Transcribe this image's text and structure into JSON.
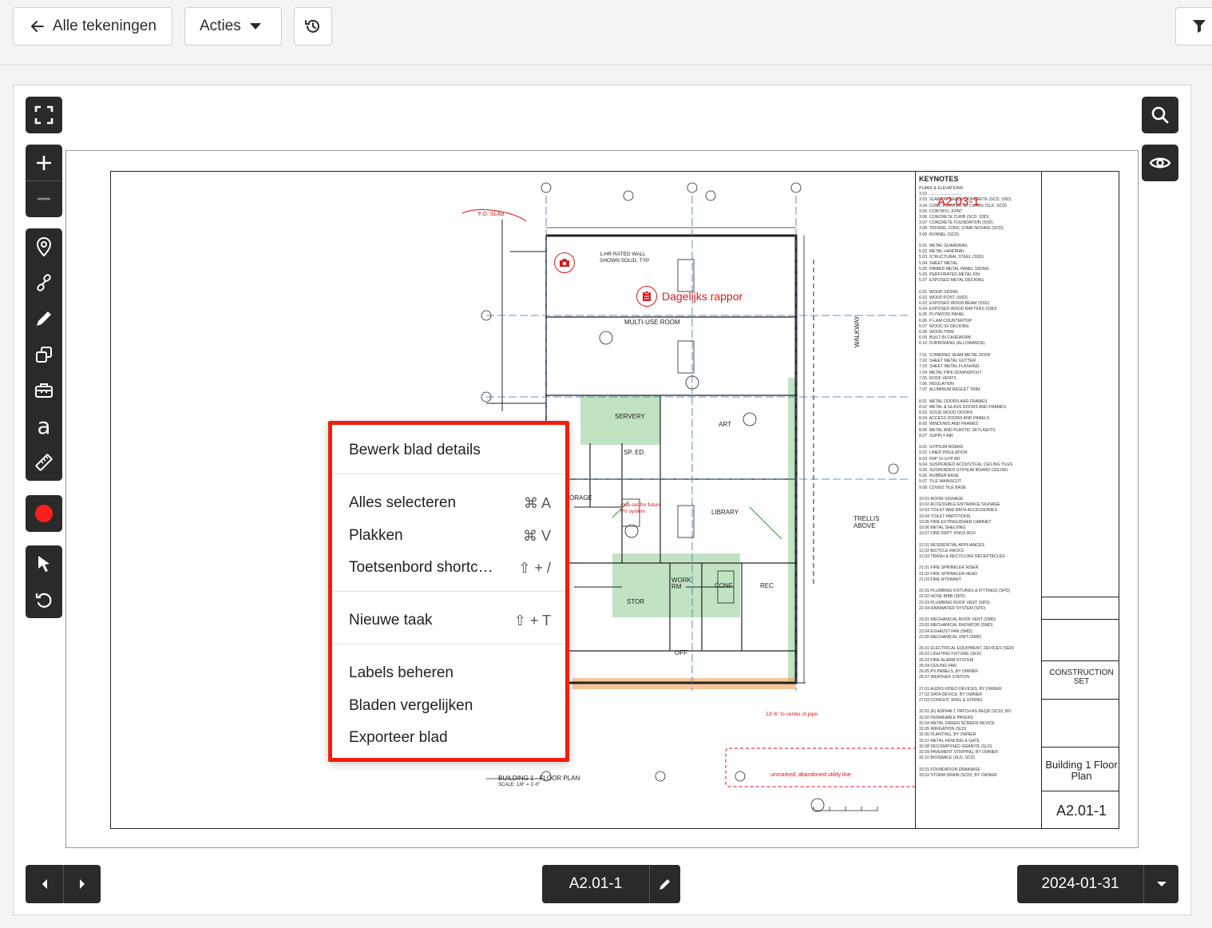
{
  "toolbar": {
    "back_label": "Alle tekeningen",
    "actions_label": "Acties"
  },
  "markups": {
    "daily_report": "Dagelijks rappor",
    "sheet_ref": "A2.03-1"
  },
  "plan_labels": {
    "multi_use": "MULTI-USE ROOM",
    "servery": "SERVERY",
    "art": "ART",
    "library": "LIBRARY",
    "sp_ed": "SP. ED.",
    "storage": "ORAGE",
    "work_rm": "WORK RM",
    "conf": "CONF",
    "rec": "REC",
    "off": "OFF",
    "stor": "STOR",
    "walkway": "WALKWAY",
    "trellis": "TRELLIS ABOVE",
    "building_plan": "BUILDING 1 - FLOOR PLAN",
    "scale": "SCALE: 1/8\" = 1'-0\"",
    "stub_out": "stub out for future PV system",
    "unmarked": "unmarked, abandoned utility line",
    "fo_slab": "F.O. SLAB",
    "rated_wall": "1-HR RATED WALL SHOWN SOLID, TYP",
    "center_pipe": "13'-6\" to center of pipe"
  },
  "title_block": {
    "keynotes_title": "KEYNOTES",
    "construction_set": "CONSTRUCTION SET",
    "sheet_title": "Building 1 Floor Plan",
    "sheet_number": "A2.01-1"
  },
  "context_menu": {
    "items": [
      {
        "label": "Bewerk blad details",
        "shortcut": ""
      },
      {
        "label": "Alles selecteren",
        "shortcut": "⌘ A"
      },
      {
        "label": "Plakken",
        "shortcut": "⌘ V"
      },
      {
        "label": "Toetsenbord shortc…",
        "shortcut": "⇧ + /"
      },
      {
        "label": "Nieuwe taak",
        "shortcut": "⇧ + T"
      },
      {
        "label": "Labels beheren",
        "shortcut": ""
      },
      {
        "label": "Bladen vergelijken",
        "shortcut": ""
      },
      {
        "label": "Exporteer blad",
        "shortcut": ""
      }
    ]
  },
  "bottom": {
    "sheet_label": "A2.01-1",
    "date_label": "2024-01-31"
  },
  "colors": {
    "toolbar_dark": "#2a2a2a",
    "markup_red": "#d61d1d",
    "menu_border": "#f21d0a",
    "record_red": "#ff1f1f",
    "highlight_green": "#4caf50",
    "highlight_orange": "#f0a050"
  }
}
